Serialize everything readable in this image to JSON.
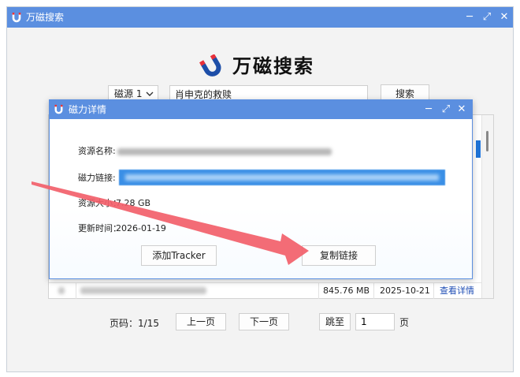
{
  "app": {
    "title": "万磁搜索",
    "logo_text": "万磁搜索",
    "accent_color": "#5b8fe0",
    "icon": "magnet-icon"
  },
  "window_controls": {
    "minimize": "─",
    "maximize": "⤢",
    "close": "✕"
  },
  "search": {
    "source_selected": "磁源 1",
    "query_value": "肖申克的救赎",
    "button_label": "搜索"
  },
  "results": {
    "visible_row": {
      "size": "845.76 MB",
      "date": "2025-10-21",
      "action": "查看详情"
    }
  },
  "pager": {
    "page_label": "页码：",
    "page_value": "1/15",
    "prev_label": "上一页",
    "next_label": "下一页",
    "jump_label": "跳至",
    "jump_value": "1",
    "page_unit": "页"
  },
  "dialog": {
    "title": "磁力详情",
    "name_label": "资源名称:",
    "link_label": "磁力链接:",
    "size_label": "资源大小：",
    "size_value": "7.28 GB",
    "time_label": "更新时间：",
    "time_value": "2026-01-19",
    "add_tracker_label": "添加Tracker",
    "copy_link_label": "复制链接"
  },
  "annotation": {
    "arrow_color": "#f25f6a"
  }
}
